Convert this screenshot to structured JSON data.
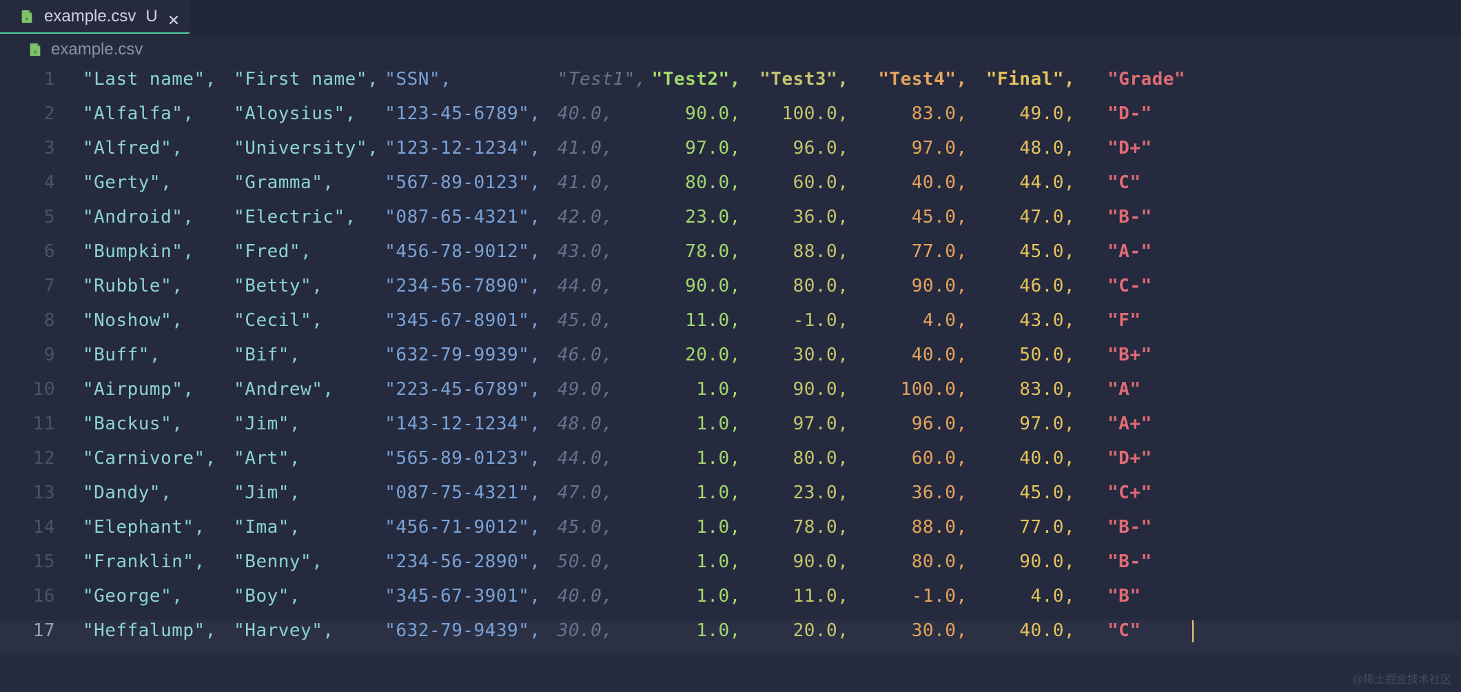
{
  "tab": {
    "title": "example.csv",
    "unsaved_marker": "U"
  },
  "breadcrumb": {
    "filename": "example.csv"
  },
  "watermark": "@稀土掘金技术社区",
  "columns": [
    {
      "header": "\"Last name\",",
      "cls": "str-teal",
      "hcls": "str-teal",
      "ccls": "c0"
    },
    {
      "header": "\"First name\",",
      "cls": "str-teal",
      "hcls": "str-teal",
      "ccls": "c1"
    },
    {
      "header": "\"SSN\",",
      "cls": "str-blue",
      "hcls": "str-blue",
      "ccls": "c2"
    },
    {
      "header": "\"Test1\",",
      "cls": "num-dim",
      "hcls": "dim-italic-hdr",
      "ccls": "c3"
    },
    {
      "header": "\"Test2\",",
      "cls": "num-green",
      "hcls": "hdr-green",
      "ccls": "c4"
    },
    {
      "header": "\"Test3\",",
      "cls": "num-olive",
      "hcls": "hdr-olive",
      "ccls": "c5"
    },
    {
      "header": "\"Test4\",",
      "cls": "num-orange",
      "hcls": "hdr-orange",
      "ccls": "c6"
    },
    {
      "header": "\"Final\",",
      "cls": "num-yellow",
      "hcls": "hdr-yellow",
      "ccls": "c7"
    },
    {
      "header": "\"Grade\"",
      "cls": "str-red",
      "hcls": "hdr-red",
      "ccls": "c8"
    }
  ],
  "rows": [
    {
      "ln": 2,
      "cells": [
        "\"Alfalfa\",",
        "\"Aloysius\",",
        "\"123-45-6789\",",
        "40.0,",
        "90.0,",
        "100.0,",
        "83.0,",
        "49.0,",
        "\"D-\""
      ]
    },
    {
      "ln": 3,
      "cells": [
        "\"Alfred\",",
        "\"University\",",
        "\"123-12-1234\",",
        "41.0,",
        "97.0,",
        "96.0,",
        "97.0,",
        "48.0,",
        "\"D+\""
      ]
    },
    {
      "ln": 4,
      "cells": [
        "\"Gerty\",",
        "\"Gramma\",",
        "\"567-89-0123\",",
        "41.0,",
        "80.0,",
        "60.0,",
        "40.0,",
        "44.0,",
        "\"C\""
      ]
    },
    {
      "ln": 5,
      "cells": [
        "\"Android\",",
        "\"Electric\",",
        "\"087-65-4321\",",
        "42.0,",
        "23.0,",
        "36.0,",
        "45.0,",
        "47.0,",
        "\"B-\""
      ]
    },
    {
      "ln": 6,
      "cells": [
        "\"Bumpkin\",",
        "\"Fred\",",
        "\"456-78-9012\",",
        "43.0,",
        "78.0,",
        "88.0,",
        "77.0,",
        "45.0,",
        "\"A-\""
      ]
    },
    {
      "ln": 7,
      "cells": [
        "\"Rubble\",",
        "\"Betty\",",
        "\"234-56-7890\",",
        "44.0,",
        "90.0,",
        "80.0,",
        "90.0,",
        "46.0,",
        "\"C-\""
      ]
    },
    {
      "ln": 8,
      "cells": [
        "\"Noshow\",",
        "\"Cecil\",",
        "\"345-67-8901\",",
        "45.0,",
        "11.0,",
        "-1.0,",
        "4.0,",
        "43.0,",
        "\"F\""
      ]
    },
    {
      "ln": 9,
      "cells": [
        "\"Buff\",",
        "\"Bif\",",
        "\"632-79-9939\",",
        "46.0,",
        "20.0,",
        "30.0,",
        "40.0,",
        "50.0,",
        "\"B+\""
      ]
    },
    {
      "ln": 10,
      "cells": [
        "\"Airpump\",",
        "\"Andrew\",",
        "\"223-45-6789\",",
        "49.0,",
        "1.0,",
        "90.0,",
        "100.0,",
        "83.0,",
        "\"A\""
      ]
    },
    {
      "ln": 11,
      "cells": [
        "\"Backus\",",
        "\"Jim\",",
        "\"143-12-1234\",",
        "48.0,",
        "1.0,",
        "97.0,",
        "96.0,",
        "97.0,",
        "\"A+\""
      ]
    },
    {
      "ln": 12,
      "cells": [
        "\"Carnivore\",",
        "\"Art\",",
        "\"565-89-0123\",",
        "44.0,",
        "1.0,",
        "80.0,",
        "60.0,",
        "40.0,",
        "\"D+\""
      ]
    },
    {
      "ln": 13,
      "cells": [
        "\"Dandy\",",
        "\"Jim\",",
        "\"087-75-4321\",",
        "47.0,",
        "1.0,",
        "23.0,",
        "36.0,",
        "45.0,",
        "\"C+\""
      ]
    },
    {
      "ln": 14,
      "cells": [
        "\"Elephant\",",
        "\"Ima\",",
        "\"456-71-9012\",",
        "45.0,",
        "1.0,",
        "78.0,",
        "88.0,",
        "77.0,",
        "\"B-\""
      ]
    },
    {
      "ln": 15,
      "cells": [
        "\"Franklin\",",
        "\"Benny\",",
        "\"234-56-2890\",",
        "50.0,",
        "1.0,",
        "90.0,",
        "80.0,",
        "90.0,",
        "\"B-\""
      ]
    },
    {
      "ln": 16,
      "cells": [
        "\"George\",",
        "\"Boy\",",
        "\"345-67-3901\",",
        "40.0,",
        "1.0,",
        "11.0,",
        "-1.0,",
        "4.0,",
        "\"B\""
      ]
    },
    {
      "ln": 17,
      "cells": [
        "\"Heffalump\",",
        "\"Harvey\",",
        "\"632-79-9439\",",
        "30.0,",
        "1.0,",
        "20.0,",
        "30.0,",
        "40.0,",
        "\"C\""
      ],
      "current": true
    }
  ],
  "chart_data": null
}
